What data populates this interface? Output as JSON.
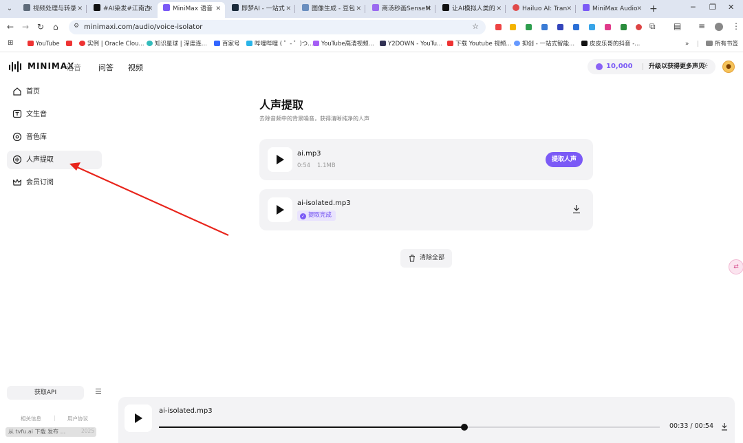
{
  "browser": {
    "tabs": [
      {
        "label": "视频处理与转录",
        "color": "#5f6b7a"
      },
      {
        "label": "#AI染发#江南古",
        "color": "#111111"
      },
      {
        "label": "MiniMax 语音",
        "color": "#7b5af6",
        "active": true
      },
      {
        "label": "即梦AI - 一站式",
        "color": "#1a2a3a"
      },
      {
        "label": "图像生成 - 豆包",
        "color": "#6b8fbf"
      },
      {
        "label": "商汤秒画SenseM",
        "color": "#9b6af0"
      },
      {
        "label": "让AI模拟人类的",
        "color": "#111111"
      },
      {
        "label": "Hailuo AI: Tran",
        "color": "#e04a4a"
      },
      {
        "label": "MiniMax Audio",
        "color": "#7b5af6"
      }
    ],
    "url": "minimaxi.com/audio/voice-isolator",
    "bookmarks": [
      {
        "label": "YouTube",
        "color": "#e33"
      },
      {
        "label": "实例 | Oracle Clou...",
        "color": "#e33"
      },
      {
        "label": "知识星球 | 深度连...",
        "color": "#3bb"
      },
      {
        "label": "百家号",
        "color": "#36f"
      },
      {
        "label": "哔哩哔哩 ( ゜- ゜)つ...",
        "color": "#2ab4e8"
      },
      {
        "label": "YouTube高清视频...",
        "color": "#a55ef5"
      },
      {
        "label": "Y2DOWN - YouTu...",
        "color": "#335"
      },
      {
        "label": "下载 Youtube 视频...",
        "color": "#e33"
      },
      {
        "label": "抑创 - 一站式智能...",
        "color": "#69f"
      },
      {
        "label": "皮皮乐哥的抖音 -...",
        "color": "#111"
      }
    ],
    "bookmarks_overflow": "»",
    "all_bookmarks": "所有书签"
  },
  "header": {
    "logo_text": "MINIMAX",
    "nav": [
      "语音",
      "问答",
      "视频"
    ],
    "credits_value": "10,000",
    "credits_text": "升级以获得更多声贝"
  },
  "sidebar": {
    "items": [
      {
        "label": "首页",
        "icon": "home-icon"
      },
      {
        "label": "文生音",
        "icon": "text-to-speech-icon"
      },
      {
        "label": "音色库",
        "icon": "voice-library-icon"
      },
      {
        "label": "人声提取",
        "icon": "voice-isolate-icon",
        "active": true
      },
      {
        "label": "会员订阅",
        "icon": "crown-icon"
      }
    ],
    "api_button": "获取API",
    "footer_links": [
      "相关信息",
      "用户协议"
    ],
    "copyright_fragment": "2025",
    "watermark": "从 tvfu.ai 下载 发布 ..."
  },
  "main": {
    "title": "人声提取",
    "subtitle": "去除音频中的背景噪音，获得清晰纯净的人声",
    "files": [
      {
        "name": "ai.mp3",
        "duration": "0:54",
        "size": "1.1MB",
        "action": "提取人声"
      },
      {
        "name": "ai-isolated.mp3",
        "status": "提取完成"
      }
    ],
    "clear_all": "清除全部"
  },
  "player": {
    "filename": "ai-isolated.mp3",
    "time": "00:33 / 00:54",
    "progress": 0.61
  },
  "colors": {
    "accent": "#7b5af6",
    "annotation_arrow": "#e8251c"
  }
}
